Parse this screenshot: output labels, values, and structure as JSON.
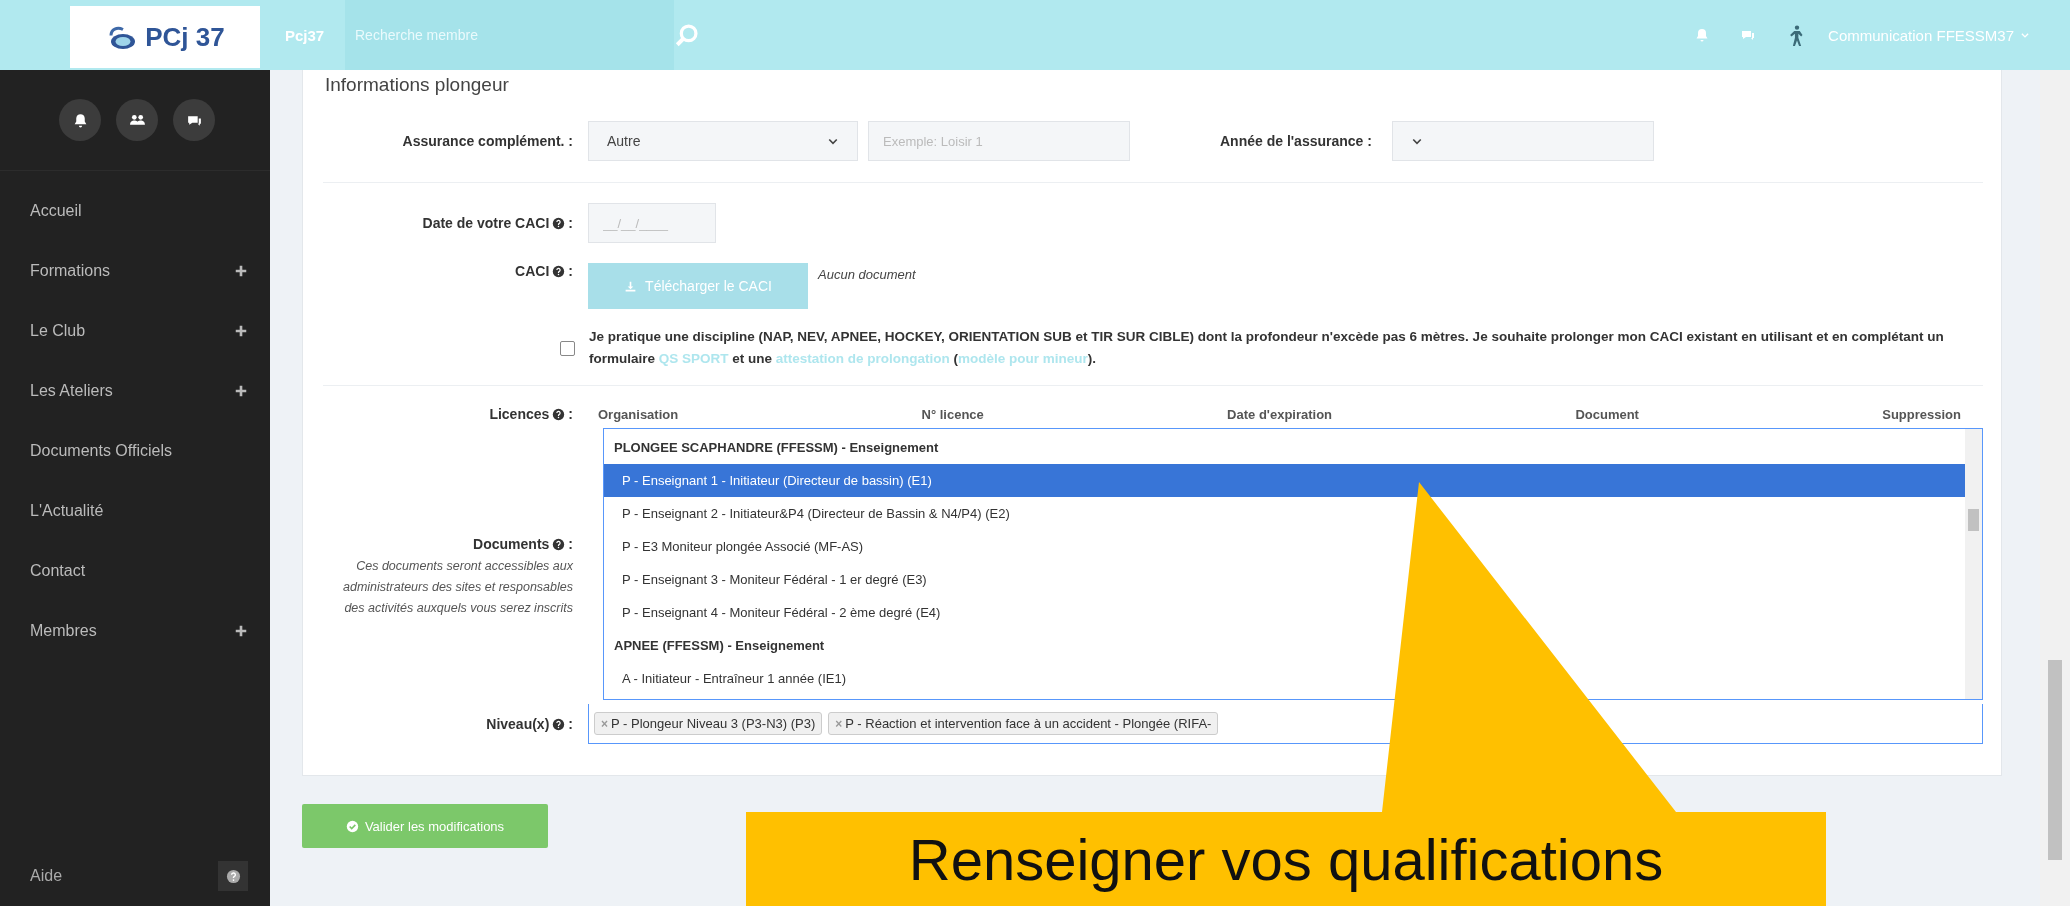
{
  "topbar": {
    "logo_text": "PCj 37",
    "brand": "Pcj37",
    "search": {
      "placeholder": "Recherche membre"
    },
    "user": "Communication FFESSM37"
  },
  "sidebar": {
    "items": [
      {
        "label": "Accueil",
        "expandable": false
      },
      {
        "label": "Formations",
        "expandable": true
      },
      {
        "label": "Le Club",
        "expandable": true
      },
      {
        "label": "Les Ateliers",
        "expandable": true
      },
      {
        "label": "Documents Officiels",
        "expandable": false
      },
      {
        "label": "L'Actualité",
        "expandable": false
      },
      {
        "label": "Contact",
        "expandable": false
      },
      {
        "label": "Membres",
        "expandable": true
      }
    ],
    "help": "Aide"
  },
  "section_title": "Informations plongeur",
  "insurance": {
    "label": "Assurance complément. :",
    "value": "Autre",
    "detail_placeholder": "Exemple: Loisir 1",
    "year_label": "Année de l'assurance :"
  },
  "caci_date": {
    "label": "Date de votre CACI",
    "colon": ":",
    "placeholder": "__/__/____"
  },
  "caci": {
    "label": "CACI",
    "colon": ":",
    "button": "Télécharger le CACI",
    "status": "Aucun document"
  },
  "extension": {
    "checked": false,
    "parts": [
      {
        "kind": "text",
        "text": "Je pratique une discipline (NAP, NEV, APNEE, HOCKEY, ORIENTATION SUB et TIR SUR CIBLE) dont la profondeur n'excède pas 6 mètres. Je souhaite prolonger mon CACI existant en utilisant et en complétant un formulaire "
      },
      {
        "kind": "link",
        "text": "QS SPORT"
      },
      {
        "kind": "text",
        "text": " et une "
      },
      {
        "kind": "link",
        "text": "attestation de prolongation"
      },
      {
        "kind": "text",
        "text": " ("
      },
      {
        "kind": "link",
        "text": "modèle pour mineur"
      },
      {
        "kind": "text",
        "text": ")."
      }
    ]
  },
  "licences": {
    "label": "Licences",
    "colon": ":",
    "columns": [
      "Organisation",
      "N° licence",
      "Date d'expiration",
      "Document",
      "Suppression"
    ],
    "options": [
      {
        "kind": "group",
        "text": "PLONGEE SCAPHANDRE (FFESSM) - Enseignement",
        "selected": false
      },
      {
        "kind": "option",
        "text": "P - Enseignant 1 - Initiateur (Directeur de bassin) (E1)",
        "selected": true
      },
      {
        "kind": "option",
        "text": "P - Enseignant 2 - Initiateur&P4 (Directeur de Bassin & N4/P4) (E2)",
        "selected": false
      },
      {
        "kind": "option",
        "text": "P - E3 Moniteur plongée Associé (MF-AS)",
        "selected": false
      },
      {
        "kind": "option",
        "text": "P - Enseignant 3 - Moniteur Fédéral - 1 er degré (E3)",
        "selected": false
      },
      {
        "kind": "option",
        "text": "P - Enseignant 4 - Moniteur Fédéral - 2 ème degré (E4)",
        "selected": false
      },
      {
        "kind": "group",
        "text": "APNEE (FFESSM) - Enseignement",
        "selected": false
      },
      {
        "kind": "option",
        "text": "A - Initiateur - Entraîneur 1 année (IE1)",
        "selected": false
      }
    ]
  },
  "documents": {
    "label": "Documents",
    "colon": ":",
    "note": "Ces documents seront accessibles aux administrateurs des sites et responsables des activités auxquels vous serez inscrits"
  },
  "levels": {
    "label": "Niveau(x)",
    "colon": ":",
    "remove": "×",
    "tags": [
      "P - Plongeur Niveau 3 (P3-N3) (P3)",
      "P - Réaction et intervention face à un accident - Plongée (RIFA-"
    ]
  },
  "submit": "Valider les modifications",
  "callout": "Renseigner vos qualifications"
}
